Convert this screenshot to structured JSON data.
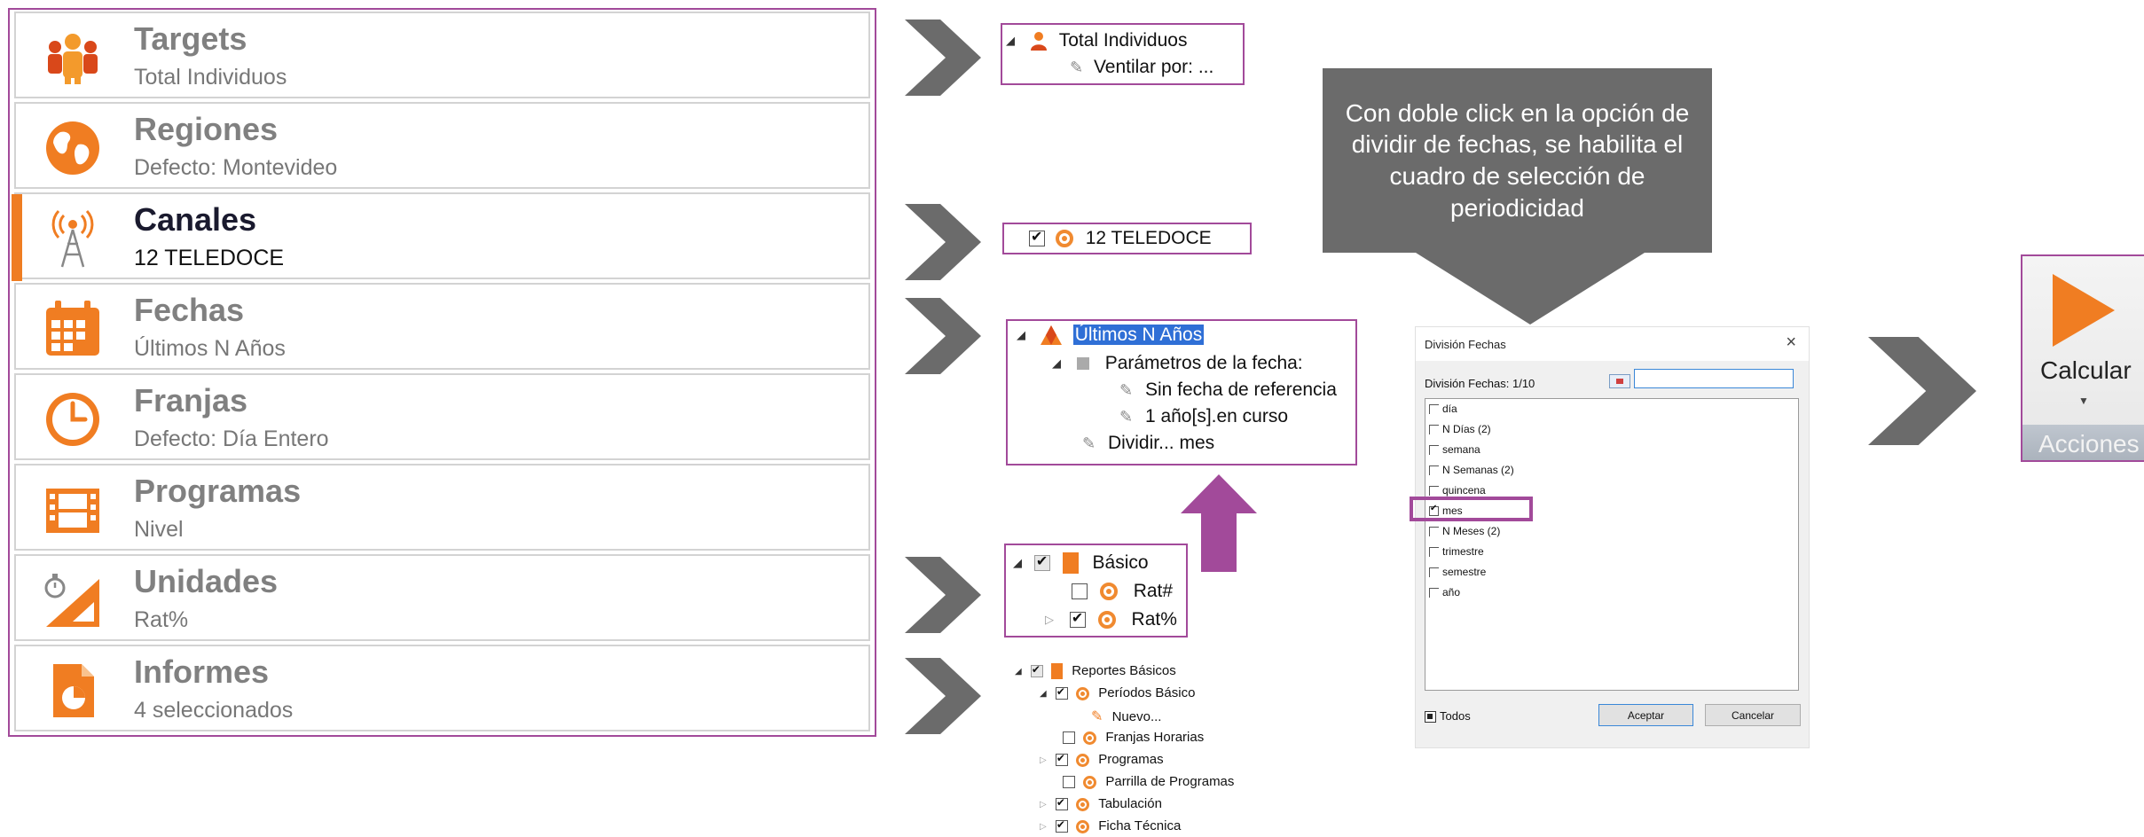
{
  "nav": {
    "items": [
      {
        "title": "Targets",
        "subtitle": "Total Individuos",
        "icon": "people-icon"
      },
      {
        "title": "Regiones",
        "subtitle": "Defecto: Montevideo",
        "icon": "globe-icon"
      },
      {
        "title": "Canales",
        "subtitle": "12 TELEDOCE",
        "icon": "antenna-icon",
        "active": true
      },
      {
        "title": "Fechas",
        "subtitle": "Últimos N Años",
        "icon": "calendar-icon"
      },
      {
        "title": "Franjas",
        "subtitle": "Defecto: Día Entero",
        "icon": "clock-icon"
      },
      {
        "title": "Programas",
        "subtitle": "Nivel",
        "icon": "film-icon"
      },
      {
        "title": "Unidades",
        "subtitle": "Rat%",
        "icon": "ruler-timer-icon"
      },
      {
        "title": "Informes",
        "subtitle": "4 seleccionados",
        "icon": "report-icon"
      }
    ],
    "accent_color": "#ef7d22",
    "border_color": "#a24a9a"
  },
  "targets_tree": {
    "root": "Total Individuos",
    "child": "Ventilar por: ..."
  },
  "canales_tree": {
    "item": "12 TELEDOCE"
  },
  "fechas_tree": {
    "root": "Últimos N Años",
    "params": "Parámetros de la fecha:",
    "ref": "Sin fecha de referencia",
    "period": "1 año[s].en curso",
    "divide": "Dividir... mes"
  },
  "unidades_tree": {
    "root": "Básico",
    "item1": "Rat#",
    "item2": "Rat%"
  },
  "informes_tree": {
    "root": "Reportes Básicos",
    "items": [
      "Períodos Básico",
      "Nuevo...",
      "Franjas Horarias",
      "Programas",
      "Parrilla de Programas",
      "Tabulación",
      "Ficha Técnica"
    ]
  },
  "callout": {
    "text": "Con doble click en la opción de dividir de fechas, se habilita el cuadro de selección de periodicidad"
  },
  "dialog": {
    "title": "División Fechas",
    "close": "×",
    "label": "División Fechas: 1/10",
    "input_value": "",
    "options": [
      "día",
      "N Días (2)",
      "semana",
      "N Semanas (2)",
      "quincena",
      "mes",
      "N Meses (2)",
      "trimestre",
      "semestre",
      "año"
    ],
    "checked": "mes",
    "todos": "Todos",
    "accept": "Aceptar",
    "cancel": "Cancelar"
  },
  "ribbon": {
    "button": "Calcular",
    "group": "Acciones"
  }
}
